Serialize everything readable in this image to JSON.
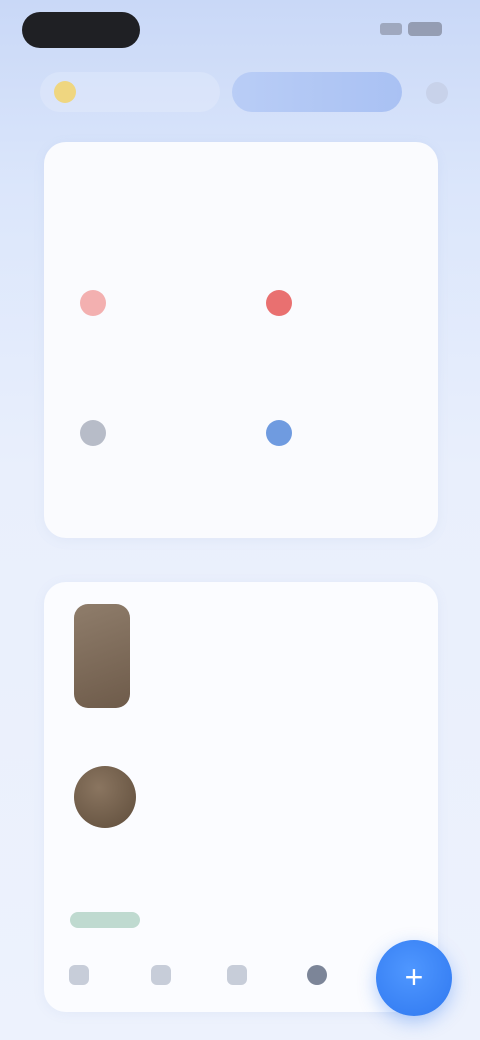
{
  "top_tabs": {
    "active_label": "",
    "more_icon": "more-icon"
  },
  "card1": {
    "title": "",
    "subtitle": "",
    "link_label": "",
    "items": [
      {
        "name": "",
        "value": "",
        "icon": "health-icon",
        "color": "#f08a8a"
      },
      {
        "name": "",
        "value": "",
        "icon": "heart-icon",
        "color": "#e25858"
      },
      {
        "name": "",
        "value": "",
        "icon": "sleep-icon",
        "color": "#8f96a6"
      },
      {
        "name": "",
        "value": "",
        "icon": "water-icon",
        "color": "#4f86d8"
      }
    ]
  },
  "feed": [
    {
      "title": "",
      "subtitle": ""
    },
    {
      "title": "",
      "subtitle": ""
    }
  ],
  "feed_chip": "",
  "bottom_nav": [
    {
      "icon": "home-icon"
    },
    {
      "icon": "discover-icon"
    },
    {
      "icon": "device-icon"
    },
    {
      "icon": "profile-icon",
      "active": true
    }
  ],
  "fab": {
    "icon": "add-icon",
    "label": "+"
  },
  "accent": "#2f78f0"
}
